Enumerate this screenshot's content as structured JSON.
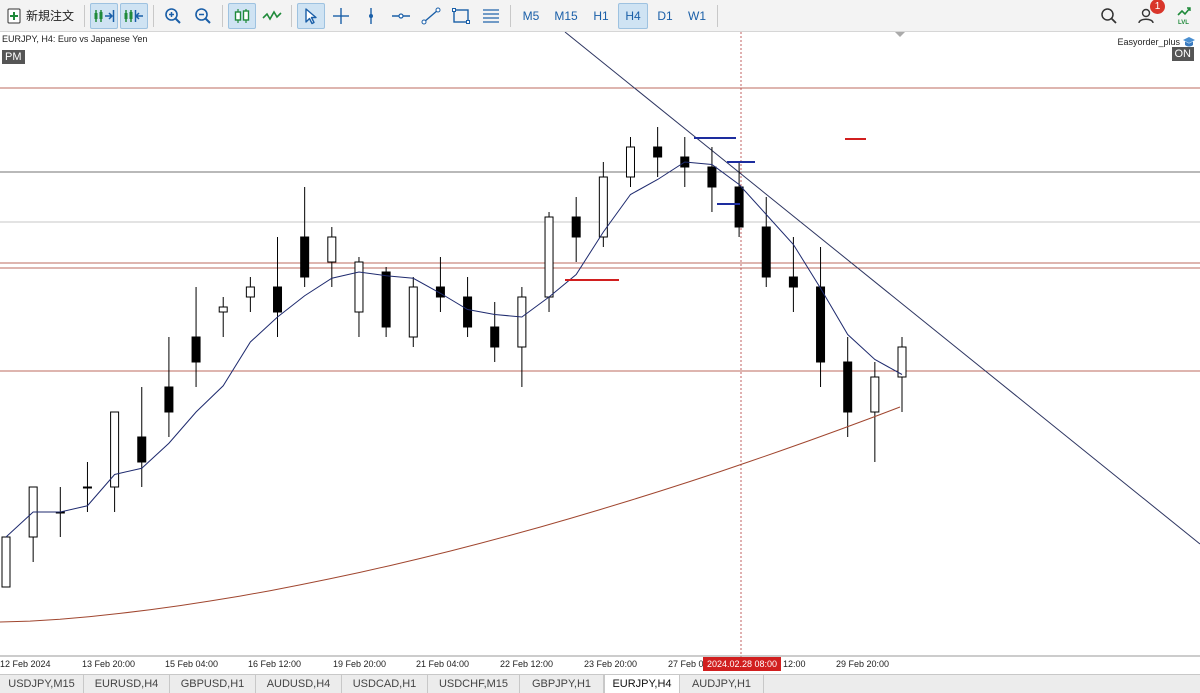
{
  "toolbar": {
    "new_order_label": "新規注文",
    "timeframes": [
      {
        "label": "M5",
        "active": false
      },
      {
        "label": "M15",
        "active": false
      },
      {
        "label": "H1",
        "active": false
      },
      {
        "label": "H4",
        "active": true
      },
      {
        "label": "D1",
        "active": false
      },
      {
        "label": "W1",
        "active": false
      }
    ],
    "notification_count": "1"
  },
  "chart": {
    "title": "EURJPY, H4:  Euro vs Japanese Yen",
    "session_label": "PM",
    "ea_name": "Easyorder_plus",
    "ea_status": "ON",
    "crosshair_time_label": "2024.02.28 08:00",
    "colors": {
      "bull_body": "#ffffff",
      "bear_body": "#000000",
      "ma_fast": "#1e2a6e",
      "ma_slow": "#a0462f",
      "level_line": "#a83a2a",
      "gray_line": "#444444",
      "trend_line": "#2d3561",
      "crosshair": "#b23a3a",
      "blue_marker": "#1d2d9e",
      "red_marker": "#d11f1f"
    }
  },
  "chart_data": {
    "type": "candlestick",
    "symbol": "EURJPY",
    "timeframe": "H4",
    "time_labels": [
      "12 Feb 2024",
      "13 Feb 20:00",
      "15 Feb 04:00",
      "16 Feb 12:00",
      "19 Feb 20:00",
      "21 Feb 04:00",
      "22 Feb 12:00",
      "23 Feb 20:00",
      "27 Feb 0",
      "12:00",
      "29 Feb 20:00"
    ],
    "candles": [
      [
        0.0,
        0.1,
        0.0,
        0.1
      ],
      [
        0.1,
        0.15,
        0.05,
        0.2
      ],
      [
        0.15,
        0.2,
        0.1,
        0.15
      ],
      [
        0.2,
        0.25,
        0.15,
        0.2
      ],
      [
        0.2,
        0.3,
        0.15,
        0.35
      ],
      [
        0.3,
        0.4,
        0.2,
        0.25
      ],
      [
        0.4,
        0.5,
        0.3,
        0.35
      ],
      [
        0.5,
        0.6,
        0.4,
        0.45
      ],
      [
        0.55,
        0.58,
        0.5,
        0.56
      ],
      [
        0.58,
        0.62,
        0.55,
        0.6
      ],
      [
        0.6,
        0.7,
        0.5,
        0.55
      ],
      [
        0.7,
        0.8,
        0.6,
        0.62
      ],
      [
        0.65,
        0.72,
        0.6,
        0.7
      ],
      [
        0.55,
        0.66,
        0.5,
        0.65
      ],
      [
        0.63,
        0.64,
        0.5,
        0.52
      ],
      [
        0.5,
        0.62,
        0.48,
        0.6
      ],
      [
        0.6,
        0.66,
        0.55,
        0.58
      ],
      [
        0.58,
        0.62,
        0.5,
        0.52
      ],
      [
        0.52,
        0.57,
        0.45,
        0.48
      ],
      [
        0.48,
        0.6,
        0.4,
        0.58
      ],
      [
        0.58,
        0.75,
        0.55,
        0.74
      ],
      [
        0.74,
        0.78,
        0.65,
        0.7
      ],
      [
        0.7,
        0.85,
        0.68,
        0.82
      ],
      [
        0.82,
        0.9,
        0.8,
        0.88
      ],
      [
        0.88,
        0.92,
        0.82,
        0.86
      ],
      [
        0.86,
        0.9,
        0.8,
        0.84
      ],
      [
        0.84,
        0.88,
        0.75,
        0.8
      ],
      [
        0.8,
        0.85,
        0.7,
        0.72
      ],
      [
        0.72,
        0.78,
        0.6,
        0.62
      ],
      [
        0.62,
        0.7,
        0.55,
        0.6
      ],
      [
        0.6,
        0.68,
        0.4,
        0.45
      ],
      [
        0.45,
        0.5,
        0.3,
        0.35
      ],
      [
        0.35,
        0.45,
        0.25,
        0.42
      ],
      [
        0.42,
        0.5,
        0.35,
        0.48
      ]
    ]
  },
  "tabs": [
    {
      "label": "USDJPY,M15",
      "active": false
    },
    {
      "label": "EURUSD,H4",
      "active": false
    },
    {
      "label": "GBPUSD,H1",
      "active": false
    },
    {
      "label": "AUDUSD,H4",
      "active": false
    },
    {
      "label": "USDCAD,H1",
      "active": false
    },
    {
      "label": "USDCHF,M15",
      "active": false
    },
    {
      "label": "GBPJPY,H1",
      "active": false
    },
    {
      "label": "EURJPY,H4",
      "active": true
    },
    {
      "label": "AUDJPY,H1",
      "active": false
    }
  ]
}
